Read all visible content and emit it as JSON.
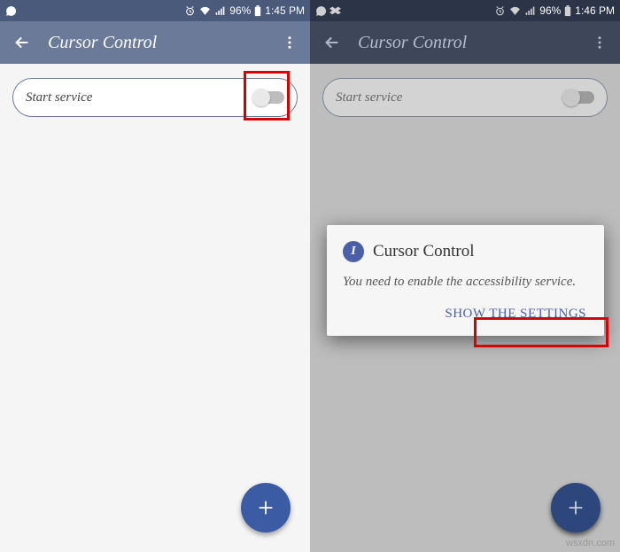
{
  "left": {
    "status": {
      "battery": "96%",
      "time": "1:45 PM"
    },
    "app_title": "Cursor Control",
    "card_label": "Start service",
    "toggle_state": false
  },
  "right": {
    "status": {
      "battery": "96%",
      "time": "1:46 PM"
    },
    "app_title": "Cursor Control",
    "card_label": "Start service",
    "toggle_state": false,
    "dialog": {
      "badge": "I",
      "title": "Cursor Control",
      "message": "You need to enable the accessibility service.",
      "action": "SHOW THE SETTINGS"
    }
  },
  "watermark": "wsxdn.com",
  "colors": {
    "accent": "#3b5ba5",
    "appbar_left": "#6b7a99",
    "appbar_right": "#3e4759",
    "highlight": "#d60000"
  }
}
